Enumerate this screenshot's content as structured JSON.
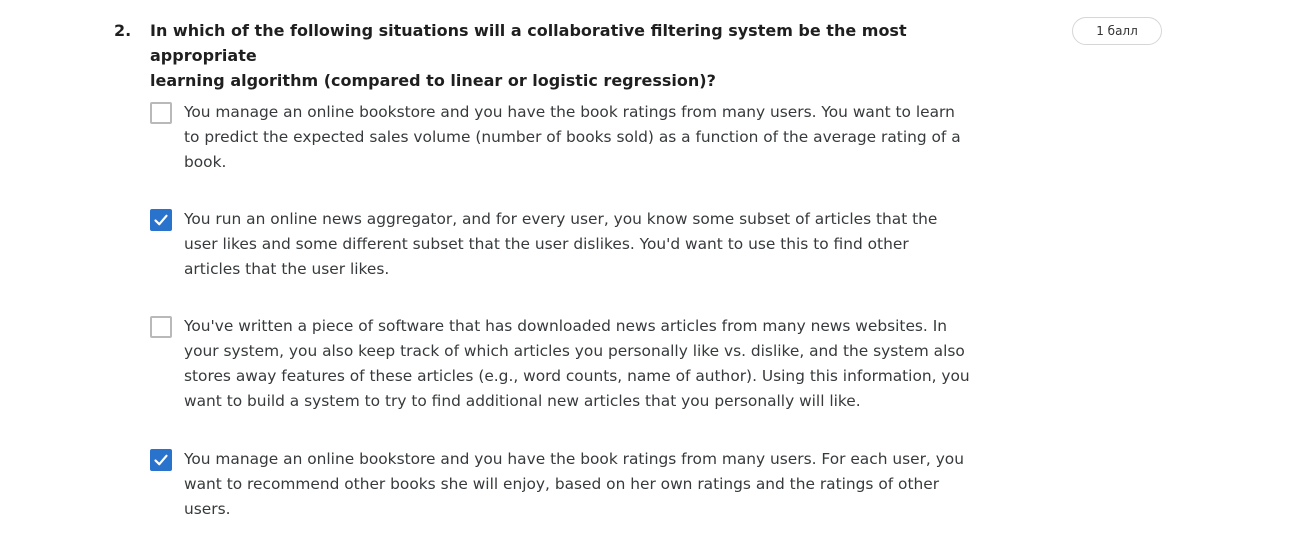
{
  "question": {
    "number": "2.",
    "text": "In which of the following situations will a collaborative filtering system be the most appropriate\nlearning algorithm (compared to linear or logistic regression)?",
    "points": "1 балл"
  },
  "options": [
    {
      "checked": false,
      "text": "You manage an online bookstore and you have the book ratings from many users. You want to learn\nto predict the expected sales volume (number of books sold) as a function of the average rating of a\nbook."
    },
    {
      "checked": true,
      "text": "You run an online news aggregator, and for every user, you know some subset of articles that the\nuser likes and some different subset that the user dislikes. You'd want to use this to find other\narticles that the user likes."
    },
    {
      "checked": false,
      "text": "You've written a piece of software that has downloaded news articles from many news websites. In\nyour system, you also keep track of which articles you personally like vs. dislike, and the system also\nstores away features of these articles (e.g., word counts, name of author). Using this information, you\nwant to build a system to try to find additional new articles that you personally will like."
    },
    {
      "checked": true,
      "text": "You manage an online bookstore and you have the book ratings from many users. For each user, you\nwant to recommend other books she will enjoy, based on her own ratings and the ratings of other\nusers."
    }
  ],
  "colors": {
    "accent": "#2a73cc",
    "checkbox_border": "#b9b9b9",
    "text": "#373a3c"
  },
  "icons": {
    "checked": "checkmark-icon"
  }
}
